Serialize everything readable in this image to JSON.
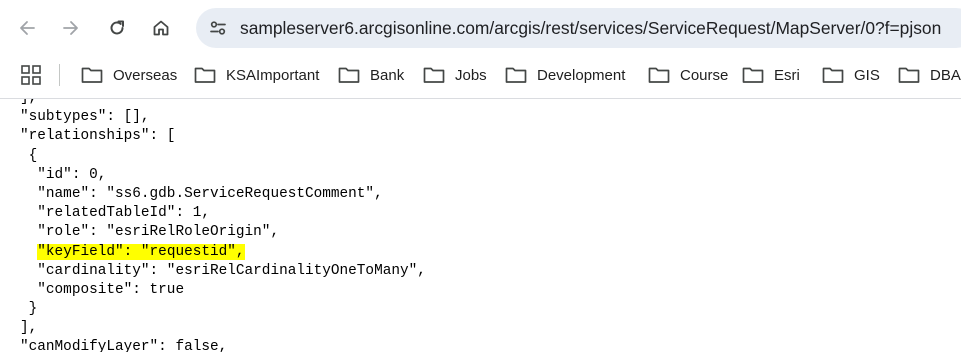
{
  "browser": {
    "url": "sampleserver6.arcgisonline.com/arcgis/rest/services/ServiceRequest/MapServer/0?f=pjson",
    "nav_icons": [
      "back-arrow-icon",
      "forward-arrow-icon",
      "reload-icon",
      "home-icon",
      "site-info-tune-icon"
    ]
  },
  "bookmarks": {
    "apps_icon": "apps-grid-icon",
    "items": [
      {
        "label": "Overseas"
      },
      {
        "label": "KSAImportant"
      },
      {
        "label": "Bank"
      },
      {
        "label": "Jobs"
      },
      {
        "label": "Development"
      },
      {
        "label": "Course"
      },
      {
        "label": "Esri"
      },
      {
        "label": "GIS"
      },
      {
        "label": "DBA"
      }
    ]
  },
  "json_view": {
    "highlight_color": "#ffff00",
    "lines": [
      "],",
      "\"subtypes\": [],",
      "\"relationships\": [",
      " {",
      "  \"id\": 0,",
      "  \"name\": \"ss6.gdb.ServiceRequestComment\",",
      "  \"relatedTableId\": 1,",
      "  \"role\": \"esriRelRoleOrigin\",",
      "  ",
      "  \"cardinality\": \"esriRelCardinalityOneToMany\",",
      "  \"composite\": true",
      " }",
      "],",
      "\"canModifyLayer\": false,"
    ],
    "highlighted_text": "\"keyField\": \"requestid\","
  }
}
